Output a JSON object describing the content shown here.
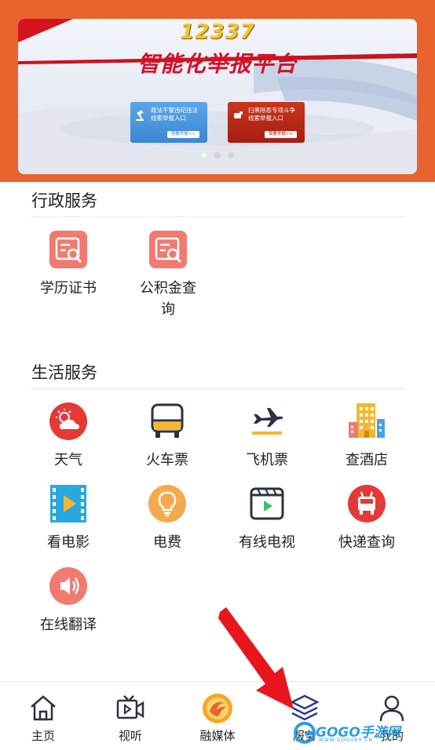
{
  "banner": {
    "number": "12337",
    "headline": "智能化举报平台",
    "card_left": {
      "line1": "政法干警违纪违法",
      "line2": "线索举报入口",
      "button": "我要举报>>"
    },
    "card_right": {
      "line1": "扫黑除恶专项斗争",
      "line2": "线索举报入口",
      "button": "我要举报>>"
    },
    "slide_count": 3,
    "active_slide": 1
  },
  "admin_services": {
    "title": "行政服务",
    "items": [
      {
        "label": "学历证书",
        "icon": "search-document-icon"
      },
      {
        "label": "公积金查询",
        "icon": "search-document-icon"
      }
    ]
  },
  "life_services": {
    "title": "生活服务",
    "items": [
      {
        "label": "天气",
        "icon": "weather-icon"
      },
      {
        "label": "火车票",
        "icon": "train-icon"
      },
      {
        "label": "飞机票",
        "icon": "airplane-icon"
      },
      {
        "label": "查酒店",
        "icon": "hotel-icon"
      },
      {
        "label": "看电影",
        "icon": "film-icon"
      },
      {
        "label": "电费",
        "icon": "lightbulb-icon"
      },
      {
        "label": "有线电视",
        "icon": "tv-icon"
      },
      {
        "label": "快递查询",
        "icon": "delivery-icon"
      },
      {
        "label": "在线翻译",
        "icon": "speaker-icon"
      }
    ]
  },
  "tabbar": {
    "items": [
      {
        "label": "主页",
        "icon": "home-icon"
      },
      {
        "label": "视听",
        "icon": "video-icon"
      },
      {
        "label": "融媒体",
        "icon": "media-logo-icon"
      },
      {
        "label": "服务",
        "icon": "layers-icon"
      },
      {
        "label": "我的",
        "icon": "user-icon"
      }
    ],
    "active": "服务"
  },
  "watermark": {
    "text": "GOGO手游网",
    "sub": "WWW.GOGO60.CN"
  },
  "colors": {
    "header": "#e8632e",
    "accent_red": "#e53935",
    "icon_coral": "#f07a70"
  }
}
